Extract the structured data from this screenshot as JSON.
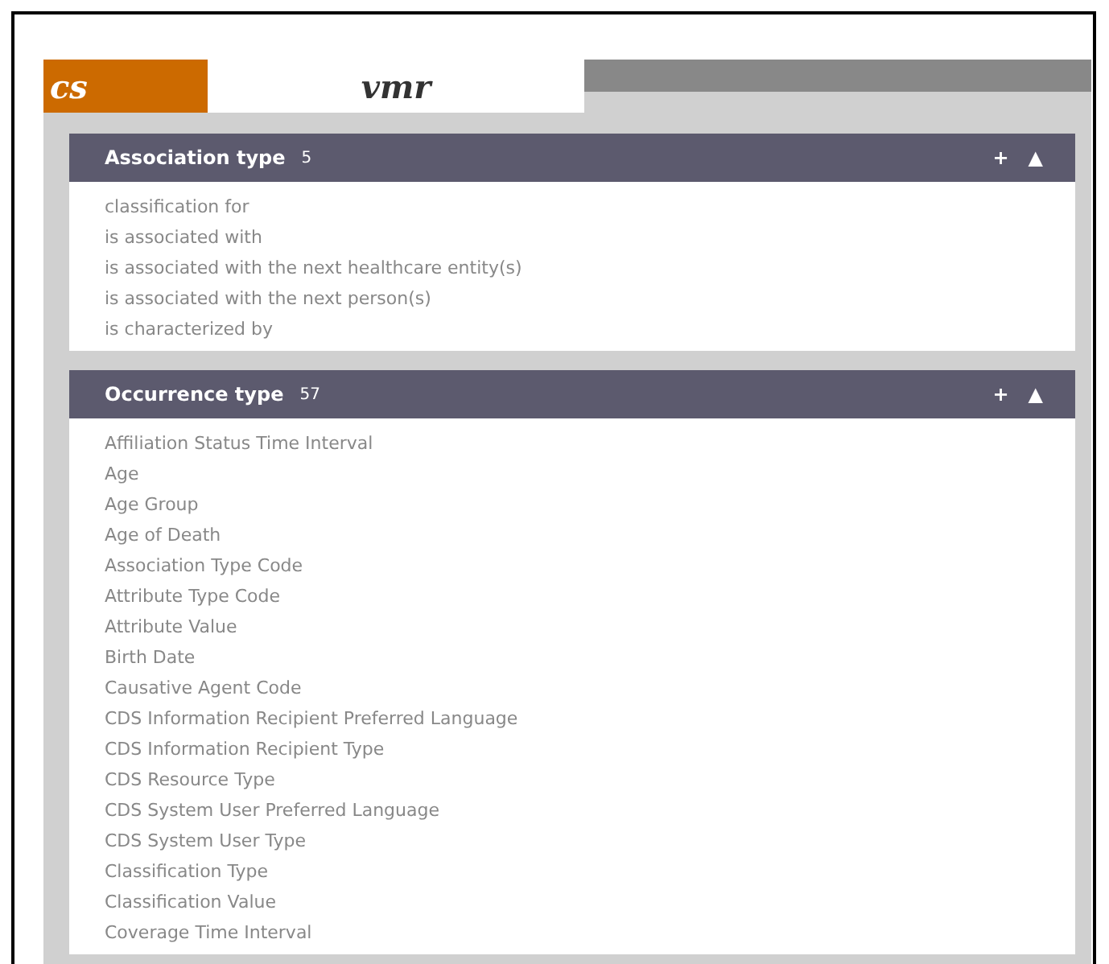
{
  "tabs": [
    {
      "label": "cs",
      "selected": false
    },
    {
      "label": "vmr",
      "selected": true
    }
  ],
  "sections": [
    {
      "title": "Association type",
      "count": "5",
      "add": "+",
      "collapse": "▲",
      "items": [
        "classification for",
        "is associated with",
        "is associated with the next healthcare entity(s)",
        "is associated with the next person(s)",
        "is characterized by"
      ]
    },
    {
      "title": "Occurrence type",
      "count": "57",
      "add": "+",
      "collapse": "▲",
      "items": [
        "Affiliation Status Time Interval",
        "Age",
        "Age Group",
        "Age of Death",
        "Association Type Code",
        "Attribute Type Code",
        "Attribute Value",
        "Birth Date",
        "Causative Agent Code",
        "CDS Information Recipient Preferred Language",
        "CDS Information Recipient Type",
        "CDS Resource Type",
        "CDS System User Preferred Language",
        "CDS System User Type",
        "Classification Type",
        "Classification Value",
        "Coverage Time Interval"
      ]
    }
  ]
}
